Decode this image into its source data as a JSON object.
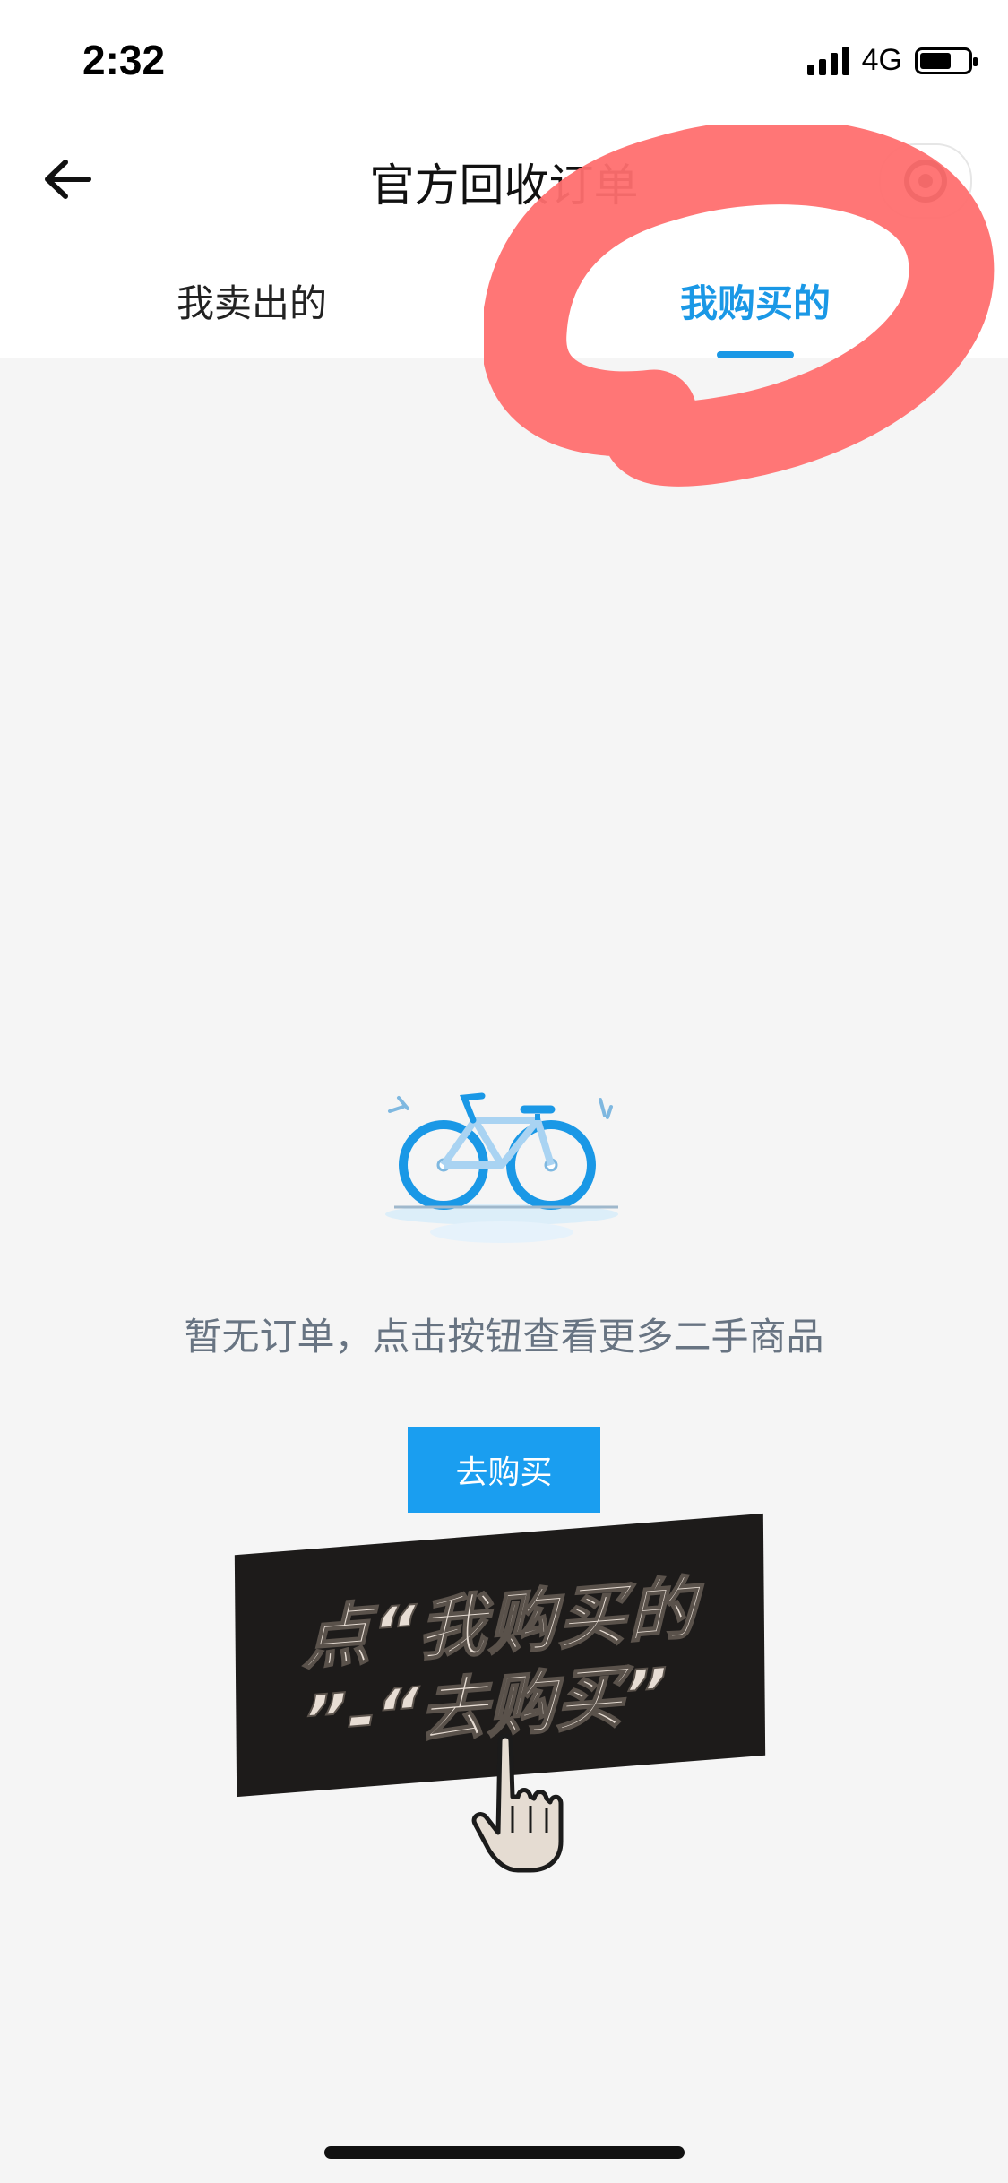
{
  "status_bar": {
    "time": "2:32",
    "network": "4G"
  },
  "nav": {
    "title": "官方回收订单",
    "back_icon": "arrow-left-icon",
    "action_icon": "target-icon"
  },
  "tabs": [
    {
      "label": "我卖出的",
      "active": false
    },
    {
      "label": "我购买的",
      "active": true
    }
  ],
  "empty_state": {
    "illustration": "bicycle-illustration",
    "message": "暂无订单，点击按钮查看更多二手商品",
    "button_label": "去购买"
  },
  "overlay": {
    "line1": "点“我购买的",
    "line2": "”-“去购买”",
    "pointer_icon": "pointing-hand-icon"
  },
  "colors": {
    "accent": "#1a98e6",
    "button": "#1a9ef0",
    "annotation_red": "#ff6f6f",
    "muted_text": "#687482",
    "background": "#f5f5f5"
  }
}
